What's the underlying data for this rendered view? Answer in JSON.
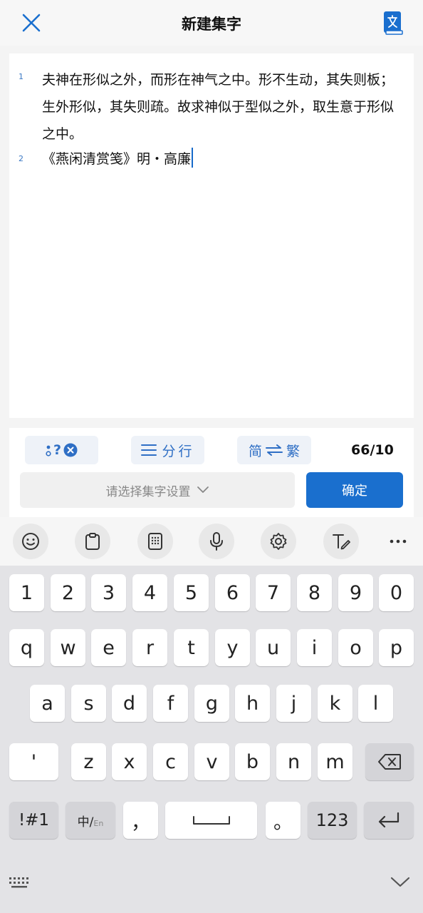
{
  "header": {
    "title": "新建集字",
    "close_icon": "close-icon",
    "dict_icon": "dictionary-book-icon"
  },
  "editor": {
    "lines": [
      {
        "number": "1",
        "text": "夫神在形似之外，而形在神气之中。形不生动，其失则板；生外形似，其失则疏。故求神似于型似之外，取生意于形似之中。"
      },
      {
        "number": "2",
        "text": "《燕闲清赏笺》明・高廉"
      }
    ]
  },
  "tools": {
    "punct_label": "?",
    "split_label": "分行",
    "convert_simplified": "简",
    "convert_traditional": "繁",
    "count": "66/10",
    "select_placeholder": "请选择集字设置",
    "confirm_label": "确定"
  },
  "keyboard_toolbar": {
    "icons": [
      "emoji-icon",
      "clipboard-icon",
      "keypad-icon",
      "microphone-icon",
      "settings-icon",
      "handwriting-icon",
      "more-icon"
    ]
  },
  "keyboard": {
    "row_numbers": [
      "1",
      "2",
      "3",
      "4",
      "5",
      "6",
      "7",
      "8",
      "9",
      "0"
    ],
    "row1": [
      "q",
      "w",
      "e",
      "r",
      "t",
      "y",
      "u",
      "i",
      "o",
      "p"
    ],
    "row2": [
      "a",
      "s",
      "d",
      "f",
      "g",
      "h",
      "j",
      "k",
      "l"
    ],
    "row3": [
      "'",
      "z",
      "x",
      "c",
      "v",
      "b",
      "n",
      "m"
    ],
    "symbols_label": "!#1",
    "lang_main": "中/",
    "lang_sub": "En",
    "comma": "，",
    "period": "。",
    "numeric_label": "123"
  },
  "colors": {
    "accent": "#1a6fce",
    "line_number": "#3a78c4",
    "tool_text": "#2f6fc5"
  }
}
